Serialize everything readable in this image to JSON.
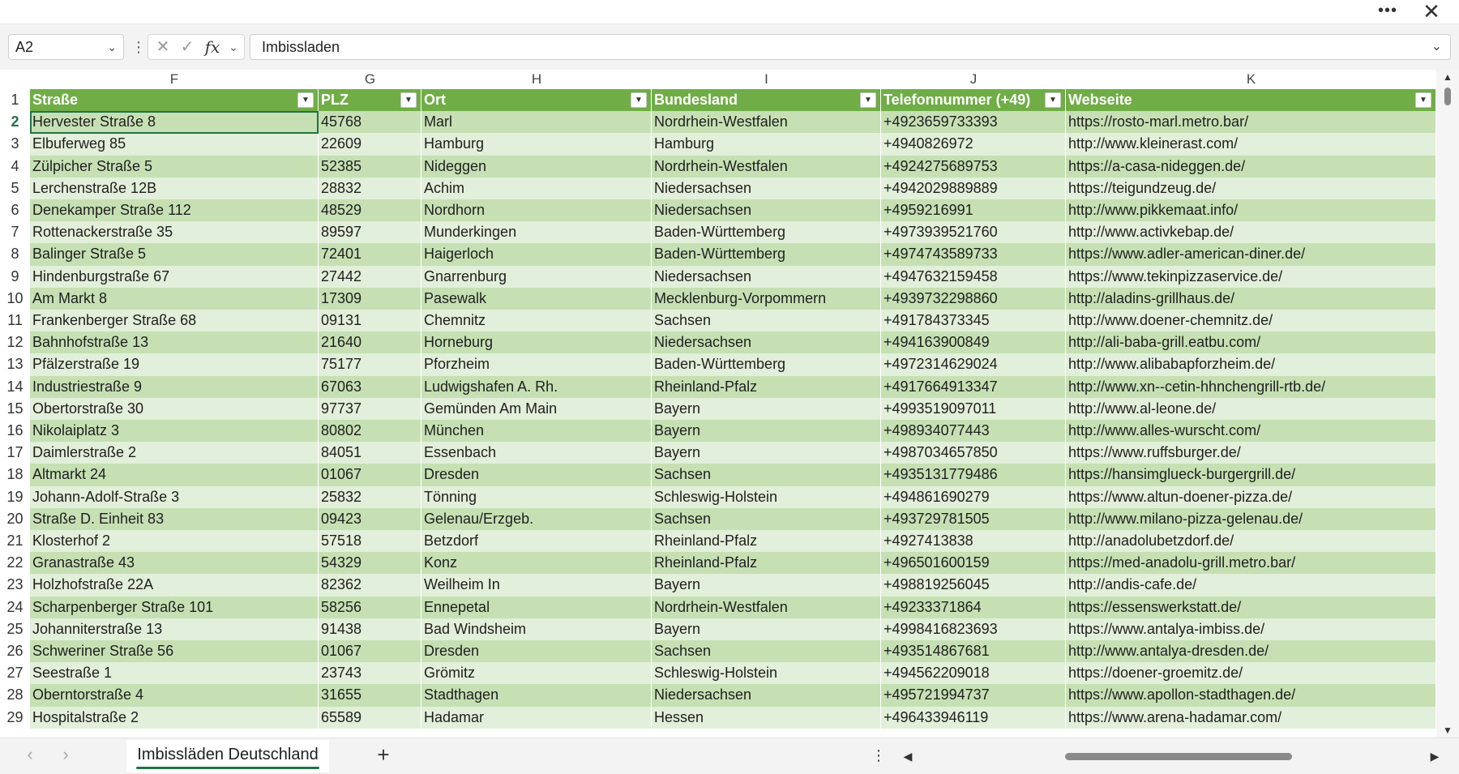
{
  "window": {
    "more_label": "•••",
    "close_label": "✕"
  },
  "formula_bar": {
    "name_box": "A2",
    "fx_label": "fx",
    "cancel_label": "✕",
    "enter_label": "✓",
    "formula_value": "Imbissladen"
  },
  "columns": [
    {
      "letter": "F",
      "header": "Straße"
    },
    {
      "letter": "G",
      "header": "PLZ"
    },
    {
      "letter": "H",
      "header": "Ort"
    },
    {
      "letter": "I",
      "header": "Bundesland"
    },
    {
      "letter": "J",
      "header": "Telefonnummer (+49)"
    },
    {
      "letter": "K",
      "header": "Webseite"
    }
  ],
  "header_row_number": "1",
  "rows": [
    {
      "n": "2",
      "cells": [
        "Hervester Straße 8",
        "45768",
        "Marl",
        "Nordrhein-Westfalen",
        "+4923659733393",
        "https://rosto-marl.metro.bar/"
      ]
    },
    {
      "n": "3",
      "cells": [
        "Elbuferweg 85",
        "22609",
        "Hamburg",
        "Hamburg",
        "+4940826972",
        "http://www.kleinerast.com/"
      ]
    },
    {
      "n": "4",
      "cells": [
        "Zülpicher Straße 5",
        "52385",
        "Nideggen",
        "Nordrhein-Westfalen",
        "+4924275689753",
        "https://a-casa-nideggen.de/"
      ]
    },
    {
      "n": "5",
      "cells": [
        "Lerchenstraße 12B",
        "28832",
        "Achim",
        "Niedersachsen",
        "+4942029889889",
        "https://teigundzeug.de/"
      ]
    },
    {
      "n": "6",
      "cells": [
        "Denekamper Straße 112",
        "48529",
        "Nordhorn",
        "Niedersachsen",
        "+4959216991",
        "http://www.pikkemaat.info/"
      ]
    },
    {
      "n": "7",
      "cells": [
        "Rottenackerstraße 35",
        "89597",
        "Munderkingen",
        "Baden-Württemberg",
        "+4973939521760",
        "http://www.activkebap.de/"
      ]
    },
    {
      "n": "8",
      "cells": [
        "Balinger Straße 5",
        "72401",
        "Haigerloch",
        "Baden-Württemberg",
        "+4974743589733",
        "https://www.adler-american-diner.de/"
      ]
    },
    {
      "n": "9",
      "cells": [
        "Hindenburgstraße 67",
        "27442",
        "Gnarrenburg",
        "Niedersachsen",
        "+4947632159458",
        "https://www.tekinpizzaservice.de/"
      ]
    },
    {
      "n": "10",
      "cells": [
        "Am Markt 8",
        "17309",
        "Pasewalk",
        "Mecklenburg-Vorpommern",
        "+4939732298860",
        "http://aladins-grillhaus.de/"
      ]
    },
    {
      "n": "11",
      "cells": [
        "Frankenberger Straße 68",
        "09131",
        "Chemnitz",
        "Sachsen",
        "+491784373345",
        "http://www.doener-chemnitz.de/"
      ]
    },
    {
      "n": "12",
      "cells": [
        "Bahnhofstraße 13",
        "21640",
        "Horneburg",
        "Niedersachsen",
        "+494163900849",
        "http://ali-baba-grill.eatbu.com/"
      ]
    },
    {
      "n": "13",
      "cells": [
        "Pfälzerstraße 19",
        "75177",
        "Pforzheim",
        "Baden-Württemberg",
        "+4972314629024",
        "http://www.alibabapforzheim.de/"
      ]
    },
    {
      "n": "14",
      "cells": [
        "Industriestraße 9",
        "67063",
        "Ludwigshafen A. Rh.",
        "Rheinland-Pfalz",
        "+4917664913347",
        "http://www.xn--cetin-hhnchengrill-rtb.de/"
      ]
    },
    {
      "n": "15",
      "cells": [
        "Obertorstraße 30",
        "97737",
        "Gemünden Am Main",
        "Bayern",
        "+4993519097011",
        "http://www.al-leone.de/"
      ]
    },
    {
      "n": "16",
      "cells": [
        "Nikolaiplatz 3",
        "80802",
        "München",
        "Bayern",
        "+498934077443",
        "http://www.alles-wurscht.com/"
      ]
    },
    {
      "n": "17",
      "cells": [
        "Daimlerstraße 2",
        "84051",
        "Essenbach",
        "Bayern",
        "+4987034657850",
        "https://www.ruffsburger.de/"
      ]
    },
    {
      "n": "18",
      "cells": [
        "Altmarkt 24",
        "01067",
        "Dresden",
        "Sachsen",
        "+4935131779486",
        "https://hansimglueck-burgergrill.de/"
      ]
    },
    {
      "n": "19",
      "cells": [
        "Johann-Adolf-Straße 3",
        "25832",
        "Tönning",
        "Schleswig-Holstein",
        "+494861690279",
        "https://www.altun-doener-pizza.de/"
      ]
    },
    {
      "n": "20",
      "cells": [
        "Straße D. Einheit 83",
        "09423",
        "Gelenau/Erzgeb.",
        "Sachsen",
        "+493729781505",
        "http://www.milano-pizza-gelenau.de/"
      ]
    },
    {
      "n": "21",
      "cells": [
        "Klosterhof 2",
        "57518",
        "Betzdorf",
        "Rheinland-Pfalz",
        "+4927413838",
        "http://anadolubetzdorf.de/"
      ]
    },
    {
      "n": "22",
      "cells": [
        "Granastraße 43",
        "54329",
        "Konz",
        "Rheinland-Pfalz",
        "+496501600159",
        "https://med-anadolu-grill.metro.bar/"
      ]
    },
    {
      "n": "23",
      "cells": [
        "Holzhofstraße 22A",
        "82362",
        "Weilheim In",
        "Bayern",
        "+498819256045",
        "http://andis-cafe.de/"
      ]
    },
    {
      "n": "24",
      "cells": [
        "Scharpenberger Straße 101",
        "58256",
        "Ennepetal",
        "Nordrhein-Westfalen",
        "+49233371864",
        "https://essenswerkstatt.de/"
      ]
    },
    {
      "n": "25",
      "cells": [
        "Johanniterstraße 13",
        "91438",
        "Bad Windsheim",
        "Bayern",
        "+4998416823693",
        "https://www.antalya-imbiss.de/"
      ]
    },
    {
      "n": "26",
      "cells": [
        "Schweriner Straße 56",
        "01067",
        "Dresden",
        "Sachsen",
        "+493514867681",
        "http://www.antalya-dresden.de/"
      ]
    },
    {
      "n": "27",
      "cells": [
        "Seestraße 1",
        "23743",
        "Grömitz",
        "Schleswig-Holstein",
        "+494562209018",
        "https://doener-groemitz.de/"
      ]
    },
    {
      "n": "28",
      "cells": [
        "Oberntorstraße 4",
        "31655",
        "Stadthagen",
        "Niedersachsen",
        "+495721994737",
        "https://www.apollon-stadthagen.de/"
      ]
    },
    {
      "n": "29",
      "cells": [
        "Hospitalstraße 2",
        "65589",
        "Hadamar",
        "Hessen",
        "+496433946119",
        "https://www.arena-hadamar.com/"
      ]
    }
  ],
  "sheets": {
    "active": "Imbissläden Deutschland",
    "add_label": "+"
  },
  "colors": {
    "header_green": "#70ad47",
    "band_dark": "#c6e0b4",
    "band_light": "#e2efda",
    "selection": "#217346"
  }
}
